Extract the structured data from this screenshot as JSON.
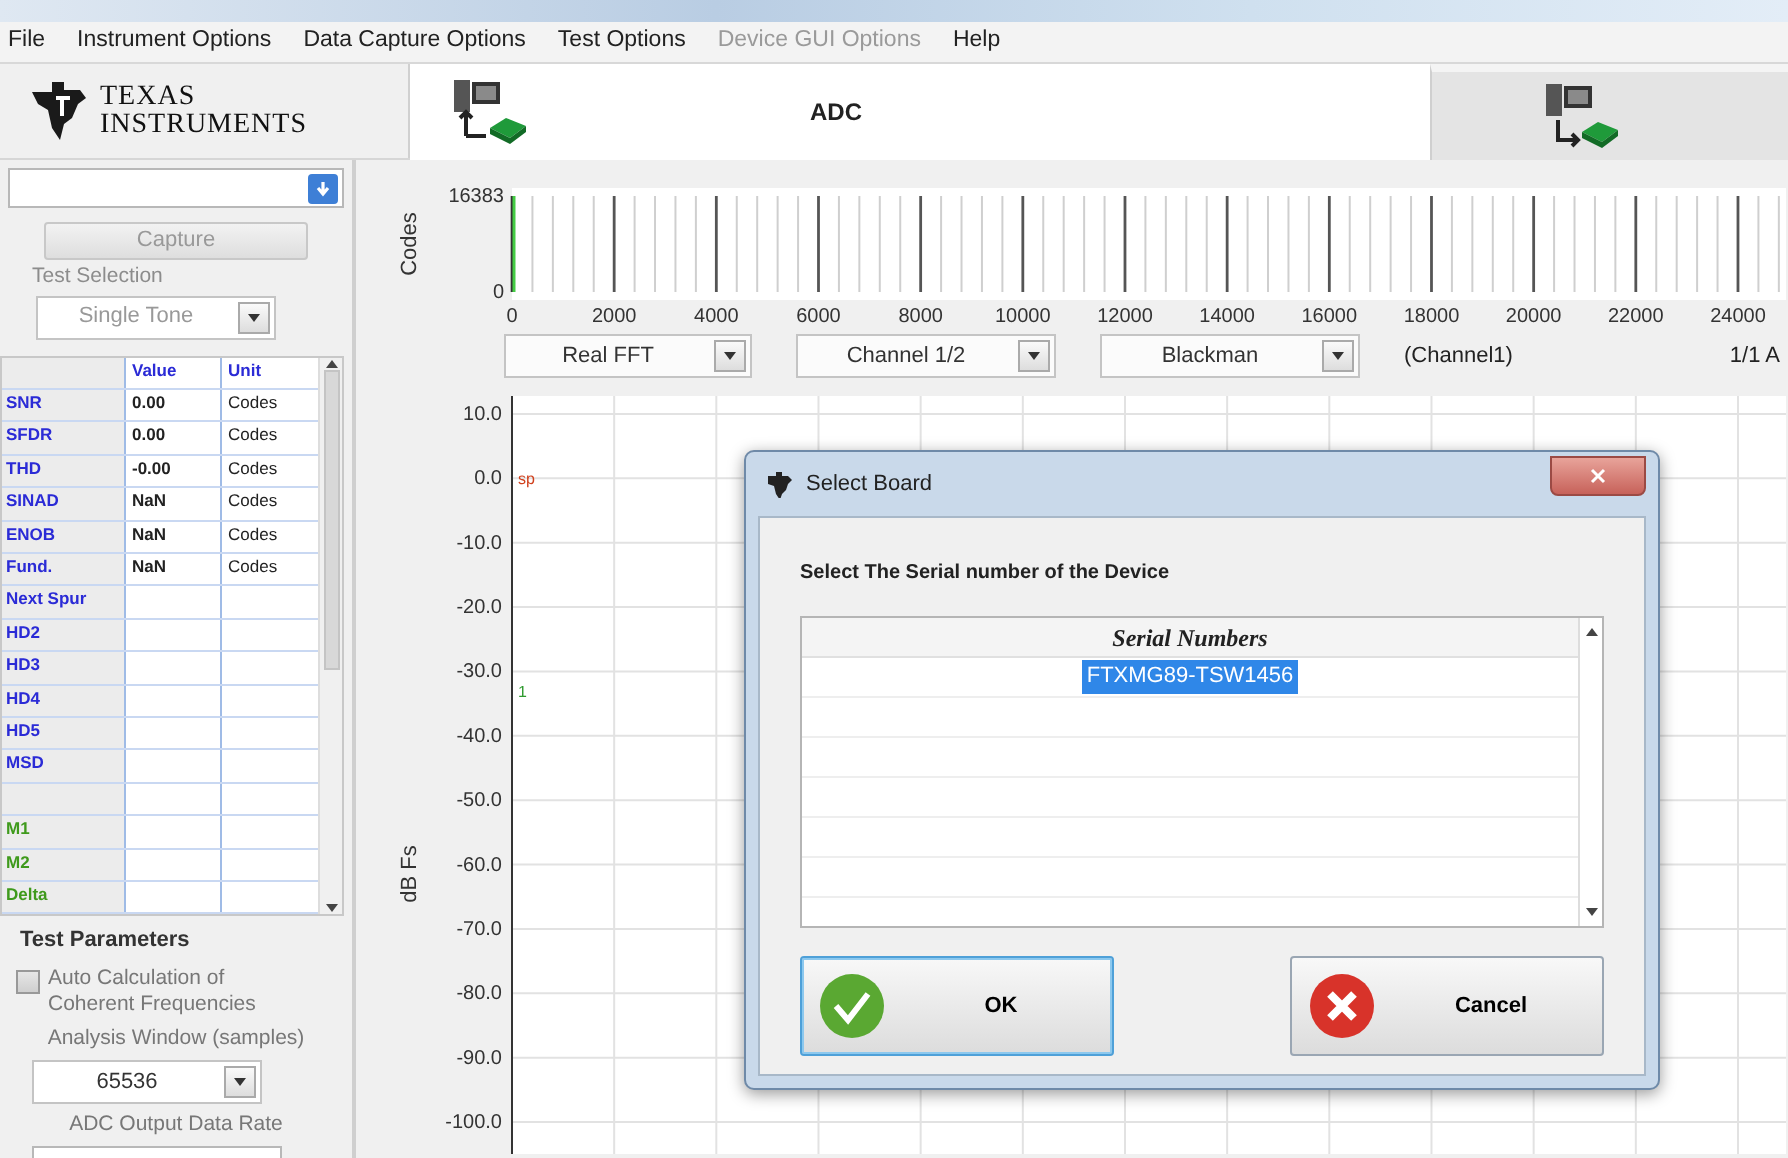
{
  "menu": [
    {
      "label": "File",
      "disabled": false
    },
    {
      "label": "Instrument Options",
      "disabled": false
    },
    {
      "label": "Data Capture Options",
      "disabled": false
    },
    {
      "label": "Test Options",
      "disabled": false
    },
    {
      "label": "Device GUI Options",
      "disabled": true
    },
    {
      "label": "Help",
      "disabled": false
    }
  ],
  "logo": {
    "line_1": "TEXAS",
    "line_2": "INSTRUMENTS"
  },
  "tabs": [
    {
      "label": "ADC",
      "kind": "receive",
      "selected": true
    },
    {
      "kind": "send",
      "selected": false
    }
  ],
  "left_panel": {
    "capture_button": "Capture",
    "test_selection_label": "Test Selection",
    "test_selection": "Single Tone",
    "table": {
      "columns": [
        "Value",
        "Unit"
      ],
      "rows": [
        {
          "kind": "metric",
          "name": "SNR",
          "value": "0.00",
          "unit": "Codes",
          "color": "#2b2bd6"
        },
        {
          "kind": "metric",
          "name": "SFDR",
          "value": "0.00",
          "unit": "Codes",
          "color": "#2b2bd6"
        },
        {
          "kind": "metric",
          "name": "THD",
          "value": "-0.00",
          "unit": "Codes",
          "color": "#2b2bd6"
        },
        {
          "kind": "metric",
          "name": "SINAD",
          "value": "NaN",
          "unit": "Codes",
          "color": "#2b2bd6"
        },
        {
          "kind": "metric",
          "name": "ENOB",
          "value": "NaN",
          "unit": "Codes",
          "color": "#2b2bd6"
        },
        {
          "kind": "metric",
          "name": "Fund.",
          "value": "NaN",
          "unit": "Codes",
          "color": "#2b2bd6"
        },
        {
          "kind": "metric",
          "name": "Next Spur",
          "color": "#2b2bd6"
        },
        {
          "kind": "metric",
          "name": "HD2",
          "color": "#2b2bd6"
        },
        {
          "kind": "metric",
          "name": "HD3",
          "color": "#2b2bd6"
        },
        {
          "kind": "metric",
          "name": "HD4",
          "color": "#2b2bd6"
        },
        {
          "kind": "metric",
          "name": "HD5",
          "color": "#2b2bd6"
        },
        {
          "kind": "metric",
          "name": "MSD",
          "color": "#2b2bd6"
        },
        {
          "kind": "spacer"
        },
        {
          "kind": "metric",
          "name": "M1",
          "color": "#3f9a1c"
        },
        {
          "kind": "metric",
          "name": "M2",
          "color": "#3f9a1c"
        },
        {
          "kind": "metric",
          "name": "Delta",
          "color": "#3f9a1c"
        }
      ]
    },
    "test_parameters_title": "Test Parameters",
    "auto_calc": {
      "label": "Auto Calculation of Coherent Frequencies",
      "checked": false
    },
    "analysis_window_label": "Analysis Window (samples)",
    "analysis_window": "65536",
    "data_rate_label": "ADC Output Data Rate"
  },
  "codes_plot": {
    "chart_data": {
      "type": "line",
      "grid": true,
      "ylabel": "Codes",
      "xlim": [
        0,
        24940
      ],
      "ylim": [
        0,
        16383
      ],
      "yticks": [
        {
          "value": 16383,
          "label": "16383"
        },
        0
      ],
      "xticks": [
        0,
        2000,
        4000,
        6000,
        8000,
        10000,
        12000,
        14000,
        16000,
        18000,
        20000,
        22000,
        24000
      ]
    }
  },
  "controls": {
    "dropdowns": [
      "Real FFT",
      "Channel 1/2",
      "Blackman"
    ],
    "channel_label": "(Channel1)",
    "page_label": "1/1 A"
  },
  "fft_plot": {
    "chart_data": {
      "type": "line",
      "grid": true,
      "ylabel": "dB Fs",
      "xlim": [
        0,
        24940
      ],
      "ylim": [
        -100,
        10
      ],
      "yticks": [
        {
          "value": 10,
          "label": "10.0"
        },
        {
          "value": 0,
          "label": "0.0"
        },
        {
          "value": -10,
          "label": "-10.0"
        },
        {
          "value": -20,
          "label": "-20.0"
        },
        {
          "value": -30,
          "label": "-30.0"
        },
        {
          "value": -40,
          "label": "-40.0"
        },
        {
          "value": -50,
          "label": "-50.0"
        },
        {
          "value": -60,
          "label": "-60.0"
        },
        {
          "value": -70,
          "label": "-70.0"
        },
        {
          "value": -80,
          "label": "-80.0"
        },
        {
          "value": -90,
          "label": "-90.0"
        },
        {
          "value": -100,
          "label": "-100.0"
        }
      ]
    },
    "markers": [
      {
        "text": "sp",
        "color": "#d0401c"
      },
      {
        "text": "1",
        "color": "#2f9a2f"
      }
    ]
  },
  "dialog": {
    "title": "Select Board",
    "prompt": "Select The Serial number of the Device",
    "list_header": "Serial Numbers",
    "items": [
      {
        "label": "FTXMG89-TSW1456",
        "selected": true
      }
    ],
    "buttons": [
      {
        "label": "OK",
        "kind": "ok",
        "focused": true
      },
      {
        "label": "Cancel",
        "kind": "cancel",
        "focused": false
      }
    ]
  }
}
